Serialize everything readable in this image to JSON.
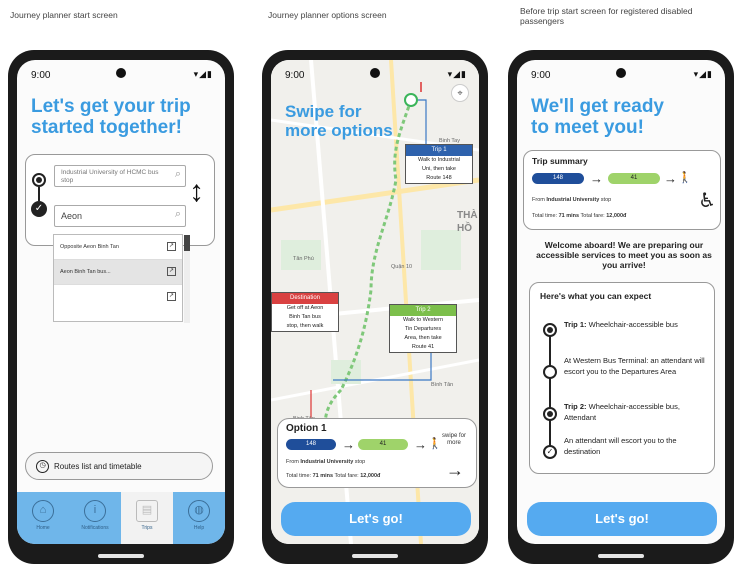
{
  "captions": {
    "left": "Journey planner start screen",
    "middle": "Journey planner options screen",
    "right": "Before trip start screen for registered disabled passengers"
  },
  "status": {
    "time": "9:00",
    "icons": "▾◢▮"
  },
  "start_screen": {
    "headline_line1": "Let's get your trip",
    "headline_line2": "started together!",
    "origin_value": "Industrial University of HCMC bus stop",
    "destination_value": "Aeon",
    "suggestions": [
      "Opposite Aeon Binh Tan",
      "Aeon Binh Tan bus...",
      ""
    ],
    "routes_button": "Routes list and timetable",
    "nav": [
      {
        "label": "Home",
        "icon": "home-icon"
      },
      {
        "label": "Notifications",
        "icon": "info-icon"
      },
      {
        "label": "Trips",
        "icon": "clipboard-icon"
      },
      {
        "label": "Help",
        "icon": "globe-icon"
      }
    ]
  },
  "options_screen": {
    "headline_line1": "Swipe for",
    "headline_line2": "more options",
    "map_labels": [
      "Binh Tay",
      "Tân Phú",
      "Quận 10",
      "Bình Tân",
      "THÀ",
      "HỒ",
      "Binh Tân"
    ],
    "trip1": {
      "header": "Trip 1",
      "lines": [
        "Walk to Industrial",
        "Uni, then take",
        "Route 148"
      ]
    },
    "trip2": {
      "header": "Trip 2",
      "lines": [
        "Walk to Western",
        "Tin Departures",
        "Area, then take",
        "Route 41"
      ]
    },
    "destination": {
      "header": "Destination",
      "lines": [
        "Get off at Aeon",
        "Binh Tan bus",
        "stop, then walk"
      ]
    },
    "option": {
      "title": "Option 1",
      "route_a": "148",
      "route_b": "41",
      "from_prefix": "From",
      "from_stop": "Industrial University",
      "from_suffix": "stop",
      "time_label": "Total time:",
      "time_value": "71 mins",
      "fare_label": "Total fare:",
      "fare_value": "12,000đ",
      "swipe_hint": "swipe for more"
    },
    "cta": "Let's go!"
  },
  "ready_screen": {
    "headline_line1": "We'll get ready",
    "headline_line2": "to meet you!",
    "summary_title": "Trip summary",
    "route_a": "148",
    "route_b": "41",
    "from_prefix": "From",
    "from_stop": "Industrial University",
    "from_suffix": "stop",
    "time_label": "Total time:",
    "time_value": "71 mins",
    "fare_label": "Total fare:",
    "fare_value": "12,000đ",
    "welcome": "Welcome aboard! We are preparing our accessible services to meet you as soon as you arrive!",
    "expect_title": "Here's what you can expect",
    "steps": [
      {
        "bold": "Trip 1:",
        "text": "Wheelchair-accessible bus"
      },
      {
        "bold": "",
        "text": "At Western Bus Terminal: an attendant will escort you to the Departures Area"
      },
      {
        "bold": "Trip 2:",
        "text": "Wheelchair-accessible bus, Attendant"
      },
      {
        "bold": "",
        "text": "An attendant will escort you to the destination"
      }
    ],
    "cta": "Let's go!"
  }
}
